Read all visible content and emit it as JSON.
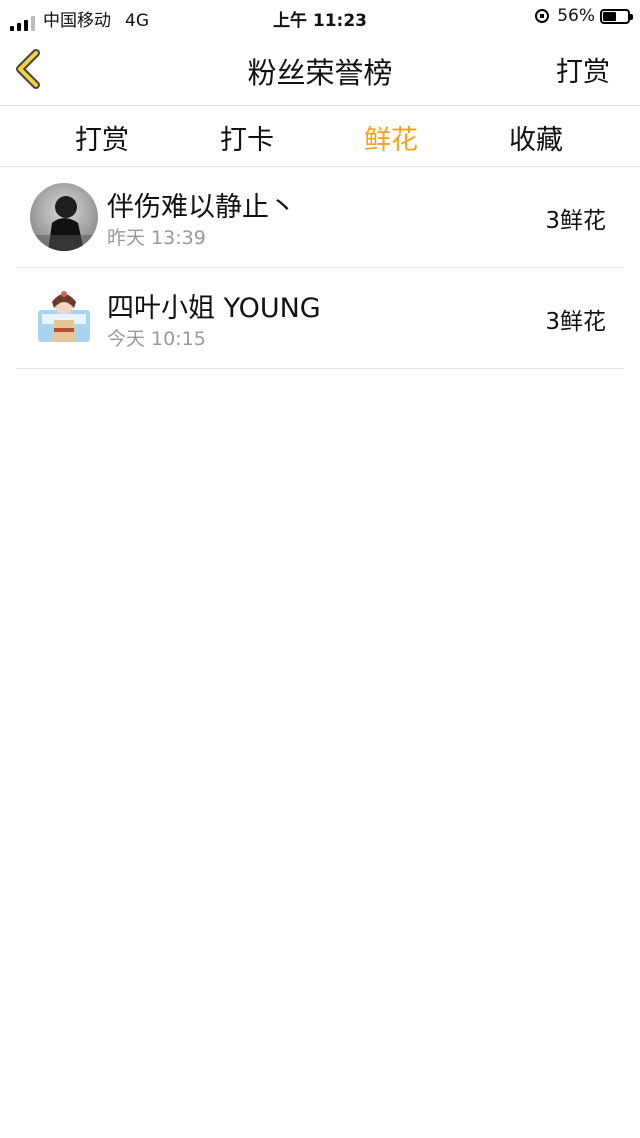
{
  "status_bar": {
    "carrier": "中国移动",
    "network": "4G",
    "time": "上午 11:23",
    "battery": "56%",
    "battery_level": 0.56
  },
  "nav": {
    "title": "粉丝荣誉榜",
    "action_label": "打赏"
  },
  "tabs": [
    {
      "label": "打赏",
      "active": false
    },
    {
      "label": "打卡",
      "active": false
    },
    {
      "label": "鲜花",
      "active": true
    },
    {
      "label": "收藏",
      "active": false
    }
  ],
  "accent_color": "#f5a319",
  "list": [
    {
      "name": "伴伤难以静止丶",
      "time": "昨天 13:39",
      "amount": "3鲜花"
    },
    {
      "name": "四叶小姐 YOUNG",
      "time": "今天 10:15",
      "amount": "3鲜花"
    }
  ]
}
